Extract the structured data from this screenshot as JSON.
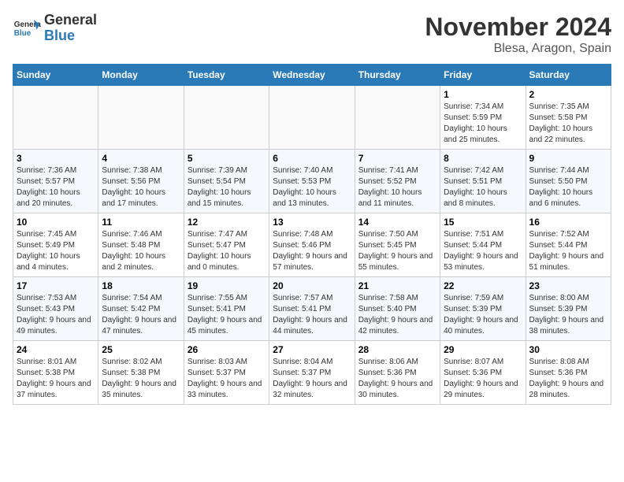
{
  "logo": {
    "general": "General",
    "blue": "Blue"
  },
  "title": "November 2024",
  "subtitle": "Blesa, Aragon, Spain",
  "days_of_week": [
    "Sunday",
    "Monday",
    "Tuesday",
    "Wednesday",
    "Thursday",
    "Friday",
    "Saturday"
  ],
  "weeks": [
    [
      {
        "day": "",
        "info": ""
      },
      {
        "day": "",
        "info": ""
      },
      {
        "day": "",
        "info": ""
      },
      {
        "day": "",
        "info": ""
      },
      {
        "day": "",
        "info": ""
      },
      {
        "day": "1",
        "info": "Sunrise: 7:34 AM\nSunset: 5:59 PM\nDaylight: 10 hours and 25 minutes."
      },
      {
        "day": "2",
        "info": "Sunrise: 7:35 AM\nSunset: 5:58 PM\nDaylight: 10 hours and 22 minutes."
      }
    ],
    [
      {
        "day": "3",
        "info": "Sunrise: 7:36 AM\nSunset: 5:57 PM\nDaylight: 10 hours and 20 minutes."
      },
      {
        "day": "4",
        "info": "Sunrise: 7:38 AM\nSunset: 5:56 PM\nDaylight: 10 hours and 17 minutes."
      },
      {
        "day": "5",
        "info": "Sunrise: 7:39 AM\nSunset: 5:54 PM\nDaylight: 10 hours and 15 minutes."
      },
      {
        "day": "6",
        "info": "Sunrise: 7:40 AM\nSunset: 5:53 PM\nDaylight: 10 hours and 13 minutes."
      },
      {
        "day": "7",
        "info": "Sunrise: 7:41 AM\nSunset: 5:52 PM\nDaylight: 10 hours and 11 minutes."
      },
      {
        "day": "8",
        "info": "Sunrise: 7:42 AM\nSunset: 5:51 PM\nDaylight: 10 hours and 8 minutes."
      },
      {
        "day": "9",
        "info": "Sunrise: 7:44 AM\nSunset: 5:50 PM\nDaylight: 10 hours and 6 minutes."
      }
    ],
    [
      {
        "day": "10",
        "info": "Sunrise: 7:45 AM\nSunset: 5:49 PM\nDaylight: 10 hours and 4 minutes."
      },
      {
        "day": "11",
        "info": "Sunrise: 7:46 AM\nSunset: 5:48 PM\nDaylight: 10 hours and 2 minutes."
      },
      {
        "day": "12",
        "info": "Sunrise: 7:47 AM\nSunset: 5:47 PM\nDaylight: 10 hours and 0 minutes."
      },
      {
        "day": "13",
        "info": "Sunrise: 7:48 AM\nSunset: 5:46 PM\nDaylight: 9 hours and 57 minutes."
      },
      {
        "day": "14",
        "info": "Sunrise: 7:50 AM\nSunset: 5:45 PM\nDaylight: 9 hours and 55 minutes."
      },
      {
        "day": "15",
        "info": "Sunrise: 7:51 AM\nSunset: 5:44 PM\nDaylight: 9 hours and 53 minutes."
      },
      {
        "day": "16",
        "info": "Sunrise: 7:52 AM\nSunset: 5:44 PM\nDaylight: 9 hours and 51 minutes."
      }
    ],
    [
      {
        "day": "17",
        "info": "Sunrise: 7:53 AM\nSunset: 5:43 PM\nDaylight: 9 hours and 49 minutes."
      },
      {
        "day": "18",
        "info": "Sunrise: 7:54 AM\nSunset: 5:42 PM\nDaylight: 9 hours and 47 minutes."
      },
      {
        "day": "19",
        "info": "Sunrise: 7:55 AM\nSunset: 5:41 PM\nDaylight: 9 hours and 45 minutes."
      },
      {
        "day": "20",
        "info": "Sunrise: 7:57 AM\nSunset: 5:41 PM\nDaylight: 9 hours and 44 minutes."
      },
      {
        "day": "21",
        "info": "Sunrise: 7:58 AM\nSunset: 5:40 PM\nDaylight: 9 hours and 42 minutes."
      },
      {
        "day": "22",
        "info": "Sunrise: 7:59 AM\nSunset: 5:39 PM\nDaylight: 9 hours and 40 minutes."
      },
      {
        "day": "23",
        "info": "Sunrise: 8:00 AM\nSunset: 5:39 PM\nDaylight: 9 hours and 38 minutes."
      }
    ],
    [
      {
        "day": "24",
        "info": "Sunrise: 8:01 AM\nSunset: 5:38 PM\nDaylight: 9 hours and 37 minutes."
      },
      {
        "day": "25",
        "info": "Sunrise: 8:02 AM\nSunset: 5:38 PM\nDaylight: 9 hours and 35 minutes."
      },
      {
        "day": "26",
        "info": "Sunrise: 8:03 AM\nSunset: 5:37 PM\nDaylight: 9 hours and 33 minutes."
      },
      {
        "day": "27",
        "info": "Sunrise: 8:04 AM\nSunset: 5:37 PM\nDaylight: 9 hours and 32 minutes."
      },
      {
        "day": "28",
        "info": "Sunrise: 8:06 AM\nSunset: 5:36 PM\nDaylight: 9 hours and 30 minutes."
      },
      {
        "day": "29",
        "info": "Sunrise: 8:07 AM\nSunset: 5:36 PM\nDaylight: 9 hours and 29 minutes."
      },
      {
        "day": "30",
        "info": "Sunrise: 8:08 AM\nSunset: 5:36 PM\nDaylight: 9 hours and 28 minutes."
      }
    ]
  ]
}
